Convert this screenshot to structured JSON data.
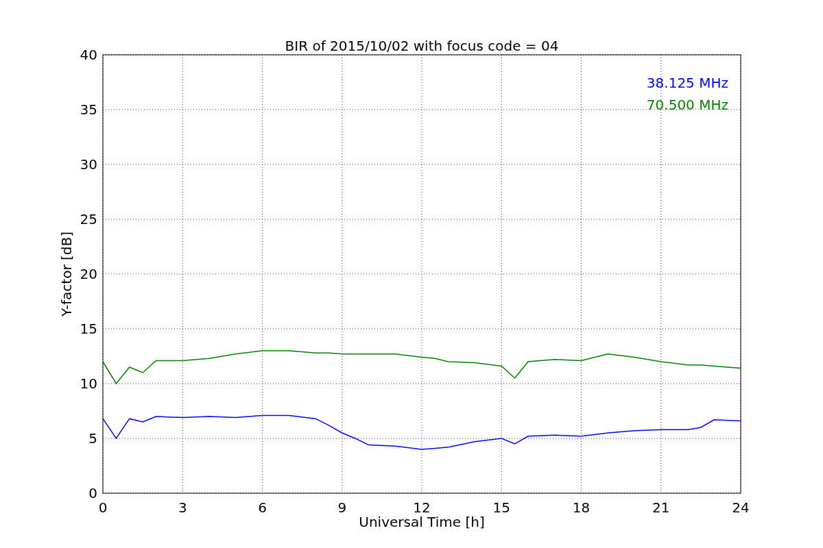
{
  "chart_data": {
    "type": "line",
    "title": "BIR of 2015/10/02 with focus code = 04",
    "xlabel": "Universal Time [h]",
    "ylabel": "Y-factor [dB]",
    "x": [
      0,
      0.5,
      1,
      1.5,
      2,
      3,
      4,
      5,
      6,
      7,
      8,
      8.5,
      9,
      9.5,
      10,
      11,
      12,
      12.5,
      13,
      14,
      15,
      15.5,
      16,
      17,
      18,
      19,
      20,
      21,
      22,
      22.5,
      23,
      24
    ],
    "series": [
      {
        "name": "38.125 MHz",
        "color": "#0000ff",
        "values": [
          6.8,
          5,
          6.8,
          6.5,
          7,
          6.9,
          7,
          6.9,
          7.1,
          7.1,
          6.8,
          6.2,
          5.5,
          5,
          4.4,
          4.3,
          4,
          4.1,
          4.2,
          4.7,
          5,
          4.5,
          5.2,
          5.3,
          5.2,
          5.5,
          5.7,
          5.8,
          5.8,
          6,
          6.7,
          6.6
        ]
      },
      {
        "name": "70.500 MHz",
        "color": "#008000",
        "values": [
          12,
          10,
          11.5,
          11,
          12.1,
          12.1,
          12.3,
          12.7,
          13,
          13,
          12.8,
          12.8,
          12.7,
          12.7,
          12.7,
          12.7,
          12.4,
          12.3,
          12,
          11.9,
          11.6,
          10.5,
          12,
          12.2,
          12.1,
          12.7,
          12.4,
          12,
          11.7,
          11.7,
          11.6,
          11.4
        ]
      }
    ],
    "xlim": [
      0,
      24
    ],
    "ylim": [
      0,
      40
    ],
    "xticks": [
      0,
      3,
      6,
      9,
      12,
      15,
      18,
      21,
      24
    ],
    "yticks": [
      0,
      5,
      10,
      15,
      20,
      25,
      30,
      35,
      40
    ],
    "grid": true
  }
}
